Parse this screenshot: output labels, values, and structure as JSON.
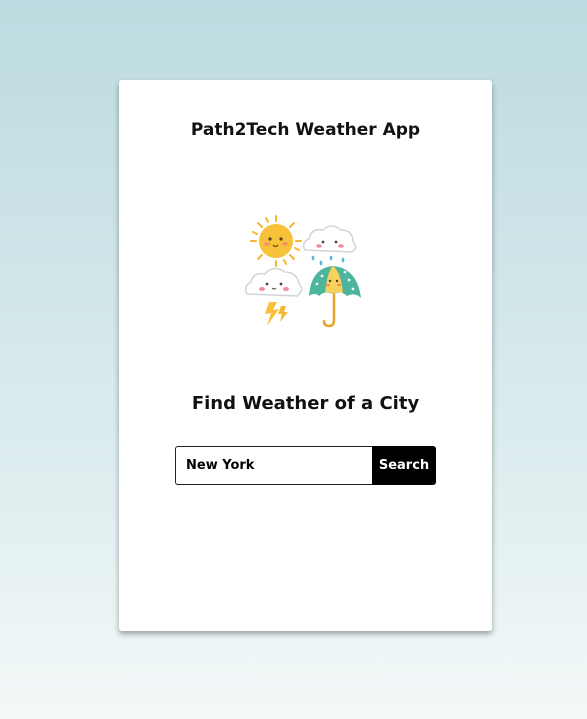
{
  "app": {
    "title": "Path2Tech Weather App"
  },
  "main": {
    "subtitle": "Find Weather of a City",
    "illustration": [
      "sun-icon",
      "rain-cloud-icon",
      "storm-cloud-icon",
      "umbrella-icon"
    ]
  },
  "search": {
    "value": "New York",
    "button_label": "Search"
  },
  "colors": {
    "background_top": "#bcdbe0",
    "background_bottom": "#f3f8f8",
    "button": "#000000",
    "sun": "#f7c13a",
    "umbrella": "#4cb59b"
  }
}
